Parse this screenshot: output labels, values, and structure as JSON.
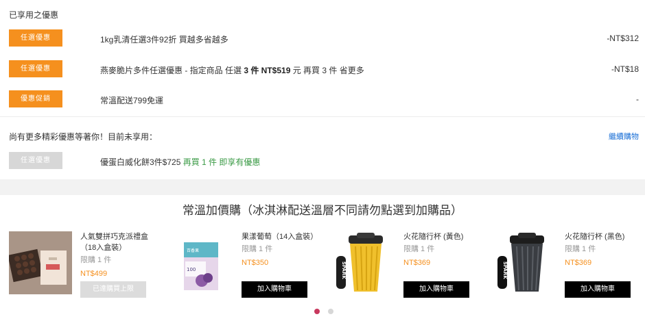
{
  "applied": {
    "heading": "已享用之優惠",
    "promos": [
      {
        "badge": "任選優惠",
        "text_plain": "1kg乳清任選3件92折 買越多省越多",
        "amount": "-NT$312"
      },
      {
        "badge": "任選優惠",
        "text_a": "燕麥脆片多件任選優惠 - 指定商品 任選 ",
        "text_b": "3 件 NT$519",
        "text_c": " 元 再買 3 件 省更多",
        "amount": "-NT$18"
      },
      {
        "badge": "優惠促銷",
        "text_plain": "常溫配送799免運",
        "amount": "-"
      }
    ]
  },
  "unapplied": {
    "heading": "尚有更多精彩優惠等著你！目前未享用：",
    "continue_link": "繼續購物",
    "promo": {
      "badge": "任選優惠",
      "text_a": "優蛋白威化餅3件$725 ",
      "text_b": "再買 1 件 即享有優惠"
    }
  },
  "addon": {
    "title": "常溫加價購（冰淇淋配送溫層不同請勿點選到加購品）",
    "products": [
      {
        "name": "人氣雙拼巧克派禮盒（18入盒裝）",
        "limit": "限購 1 件",
        "price": "NT$499",
        "button": "已達購買上限"
      },
      {
        "name": "果漾葡萄（14入盒裝）",
        "limit": "限購 1 件",
        "price": "NT$350",
        "button": "加入購物車",
        "box_text": "100",
        "box_text2": "百香果"
      },
      {
        "name": "火花隨行杯 (黃色)",
        "limit": "限購 1 件",
        "price": "NT$369",
        "button": "加入購物車",
        "strap_text": "SPARK"
      },
      {
        "name": "火花隨行杯 (黑色)",
        "limit": "限購 1 件",
        "price": "NT$369",
        "button": "加入購物車",
        "strap_text": "SPARK"
      }
    ]
  },
  "colors": {
    "orange": "#f5901e",
    "blue": "#1a6fd6",
    "green": "#3a9a45",
    "dot_active": "#c8395e"
  }
}
